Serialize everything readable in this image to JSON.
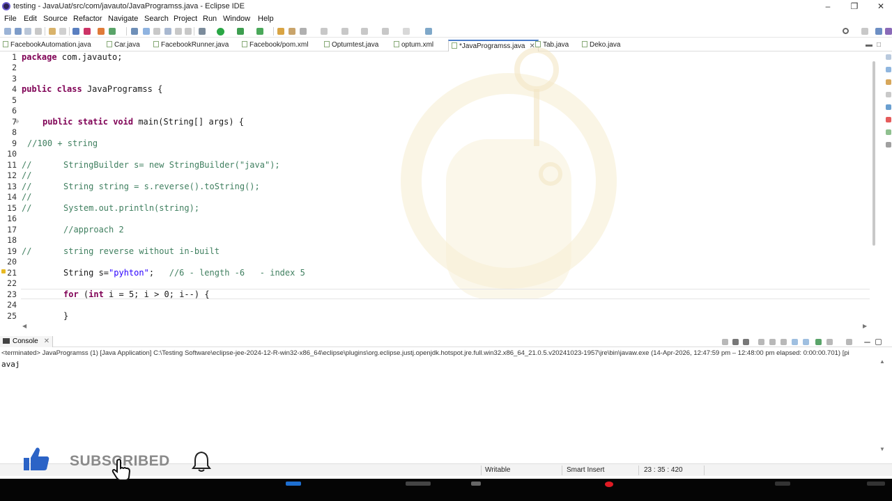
{
  "window": {
    "title": "testing - JavaUat/src/com/javauto/JavaProgramss.java - Eclipse IDE"
  },
  "menu": [
    "File",
    "Edit",
    "Source",
    "Refactor",
    "Navigate",
    "Search",
    "Project",
    "Run",
    "Window",
    "Help"
  ],
  "tabs": [
    {
      "label": "FacebookAutomation.java",
      "active": false
    },
    {
      "label": "Car.java",
      "active": false
    },
    {
      "label": "FacebookRunner.java",
      "active": false
    },
    {
      "label": "Facebook/pom.xml",
      "active": false
    },
    {
      "label": "Optumtest.java",
      "active": false
    },
    {
      "label": "optum.xml",
      "active": false
    },
    {
      "label": "*JavaProgramss.java",
      "active": true
    },
    {
      "label": "Tab.java",
      "active": false
    },
    {
      "label": "Deko.java",
      "active": false
    }
  ],
  "editor": {
    "line_numbers": [
      "1",
      "2",
      "3",
      "4",
      "5",
      "6",
      "7",
      "8",
      "9",
      "10",
      "11",
      "12",
      "13",
      "14",
      "15",
      "16",
      "17",
      "18",
      "19",
      "20",
      "21",
      "22",
      "23",
      "24",
      "25"
    ],
    "lines": {
      "l1": {
        "kw": "package",
        "rest": " com.javauto;"
      },
      "l4": {
        "kw1": "public",
        "kw2": "class",
        "rest": " JavaProgramss {"
      },
      "l7": {
        "kw1": "public",
        "kw2": "static",
        "kw3": "void",
        "rest": " main(String[] args) {"
      },
      "l9": "//100 + string",
      "l11": {
        "cm": "//",
        "rest": "StringBuilder s= new StringBuilder(\"java\");"
      },
      "l12": "//",
      "l13": {
        "cm": "//",
        "rest": "String string = s.reverse().toString();"
      },
      "l14": "//",
      "l15": {
        "cm": "//",
        "rest": "System.out.println(string);"
      },
      "l17": "//approach 2",
      "l19": {
        "cm": "//",
        "rest": "string reverse without in-built"
      },
      "l21": {
        "pre": "String s=",
        "str": "\"pyhton\"",
        "post": ";   ",
        "cm": "//6 - length -6   - index 5"
      },
      "l23": {
        "kw1": "for",
        "mid": " (",
        "kw2": "int",
        "rest": " i = 5; i > 0; i--) {"
      },
      "l25": "}"
    }
  },
  "console": {
    "tab_label": "Console",
    "terminated_line": "<terminated> JavaProgramss (1) [Java Application] C:\\Testing Software\\eclipse-jee-2024-12-R-win32-x86_64\\eclipse\\plugins\\org.eclipse.justj.openjdk.hotspot.jre.full.win32.x86_64_21.0.5.v20241023-1957\\jre\\bin\\javaw.exe  (14-Apr-2026, 12:47:59 pm – 12:48:00 pm elapsed: 0:00:00.701) [pi",
    "output": "avaj"
  },
  "statusbar": {
    "writable": "Writable",
    "insert_mode": "Smart Insert",
    "position": "23 : 35 : 420"
  },
  "overlay": {
    "subscribe_text": "SUBSCRIBED"
  },
  "colors": {
    "keyword": "#7f0055",
    "comment": "#3f7f5f",
    "string": "#2a00ff",
    "taskbar": "#050505"
  }
}
